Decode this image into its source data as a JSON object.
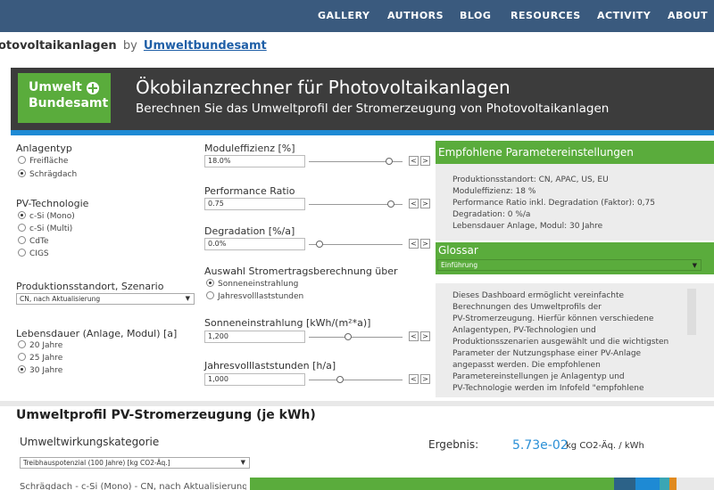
{
  "nav": {
    "items": [
      "GALLERY",
      "AUTHORS",
      "BLOG",
      "RESOURCES",
      "ACTIVITY",
      "ABOUT"
    ]
  },
  "page": {
    "viz_title": "otovoltaikanlagen",
    "by": "by",
    "author": "Umweltbundesamt"
  },
  "banner": {
    "logo_line1": "Umwelt",
    "logo_line2": "Bundesamt",
    "title": "Ökobilanzrechner für Photovoltaikanlagen",
    "subtitle": "Berechnen Sie das Umweltprofil der Stromerzeugung von Photovoltaikanlagen"
  },
  "anlagentyp": {
    "label": "Anlagentyp",
    "options": [
      "Freifläche",
      "Schrägdach"
    ],
    "selected": 1
  },
  "pvtech": {
    "label": "PV-Technologie",
    "options": [
      "c-Si (Mono)",
      "c-Si (Multi)",
      "CdTe",
      "CIGS"
    ],
    "selected": 0
  },
  "standort": {
    "label": "Produktionsstandort, Szenario",
    "value": "CN, nach Aktualisierung"
  },
  "lebensdauer": {
    "label": "Lebensdauer (Anlage, Modul) [a]",
    "options": [
      "20 Jahre",
      "25 Jahre",
      "30 Jahre"
    ],
    "selected": 2
  },
  "sliders": {
    "moduleffizienz": {
      "label": "Moduleffizienz [%]",
      "value": "18.0%",
      "level": 0.74
    },
    "performance": {
      "label": "Performance Ratio",
      "value": "0.75",
      "level": 0.76
    },
    "degradation": {
      "label": "Degradation [%/a]",
      "value": "0.0%",
      "level": 0.0
    },
    "sonne": {
      "label": "Sonneneinstrahlung [kWh/(m²*a)]",
      "value": "1,200",
      "level": 0.3
    },
    "jahresvoll": {
      "label": "Jahresvolllaststunden [h/a]",
      "value": "1,000",
      "level": 0.22
    }
  },
  "auswahl": {
    "label": "Auswahl Stromertragsberechnung über",
    "options": [
      "Sonneneinstrahlung",
      "Jahresvolllaststunden"
    ],
    "selected": 0
  },
  "empfohlen": {
    "title": "Empfohlene Parametereinstellungen",
    "lines": [
      "Produktionsstandort: CN, APAC, US, EU",
      "Moduleffizienz: 18 %",
      "Performance Ratio inkl. Degradation (Faktor): 0,75",
      "Degradation: 0 %/a",
      "Lebensdauer Anlage, Modul: 30 Jahre"
    ]
  },
  "glossar": {
    "title": "Glossar",
    "select": "Einführung",
    "lines": [
      "Dieses Dashboard ermöglicht vereinfachte",
      "Berechnungen des Umweltprofils der",
      "PV-Stromerzeugung. Hierfür können verschiedene",
      "Anlagentypen, PV-Technologien und",
      "Produktionsszenarien ausgewählt und die wichtigsten",
      "Parameter der Nutzungsphase einer PV-Anlage",
      "angepasst werden. Die empfohlenen",
      "Parametereinstellungen je Anlagentyp und",
      "PV-Technologie werden im Infofeld \"empfohlene"
    ]
  },
  "umwelt": {
    "heading": "Umweltprofil PV-Stromerzeugung (je kWh)",
    "kategorie_label": "Umweltwirkungskategorie",
    "kategorie_value": "Treibhauspotenzial (100 Jahre) [kg CO2-Äq.]",
    "ergebnis_label": "Ergebnis:",
    "ergebnis_value": "5.73e-02",
    "ergebnis_unit": "kg CO2-Äq. / kWh",
    "row_label": "Schrägdach - c-Si (Mono) - CN, nach Aktualisierung"
  },
  "colors": {
    "nav": "#3a5a7e",
    "green": "#5aac3c",
    "blue": "#1e8ad4",
    "banner": "#3c3c3c",
    "result": "#2a8fd6"
  }
}
